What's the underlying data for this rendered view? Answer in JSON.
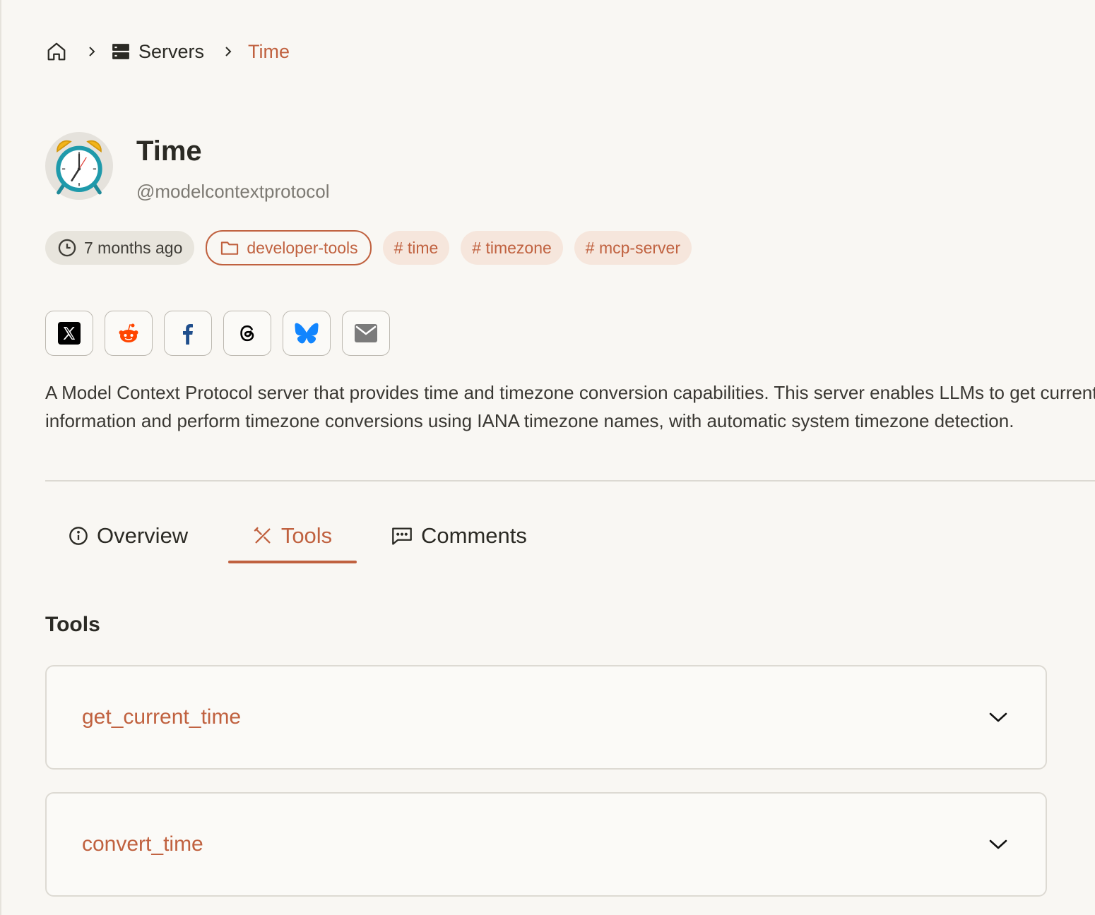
{
  "breadcrumb": {
    "home_icon": "home-icon",
    "servers_label": "Servers",
    "current_label": "Time"
  },
  "server": {
    "title": "Time",
    "handle": "@modelcontextprotocol",
    "avatar_icon": "alarm-clock-icon"
  },
  "tags": {
    "updated": "7 months ago",
    "category": "developer-tools",
    "hashtags": [
      "# time",
      "# timezone",
      "# mcp-server"
    ]
  },
  "share_buttons": [
    "x-icon",
    "reddit-icon",
    "facebook-icon",
    "threads-icon",
    "bluesky-icon",
    "email-icon"
  ],
  "description": "A Model Context Protocol server that provides time and timezone conversion capabilities. This server enables LLMs to get current time information and perform timezone conversions using IANA timezone names, with automatic system timezone detection.",
  "tabs": [
    {
      "label": "Overview",
      "icon": "info-icon",
      "active": false
    },
    {
      "label": "Tools",
      "icon": "tools-icon",
      "active": true
    },
    {
      "label": "Comments",
      "icon": "comment-icon",
      "active": false
    }
  ],
  "tools_section": {
    "title": "Tools",
    "items": [
      {
        "name": "get_current_time"
      },
      {
        "name": "convert_time"
      }
    ]
  },
  "colors": {
    "accent": "#c0613f",
    "background": "#f9f7f3",
    "text": "#2b2a24"
  }
}
